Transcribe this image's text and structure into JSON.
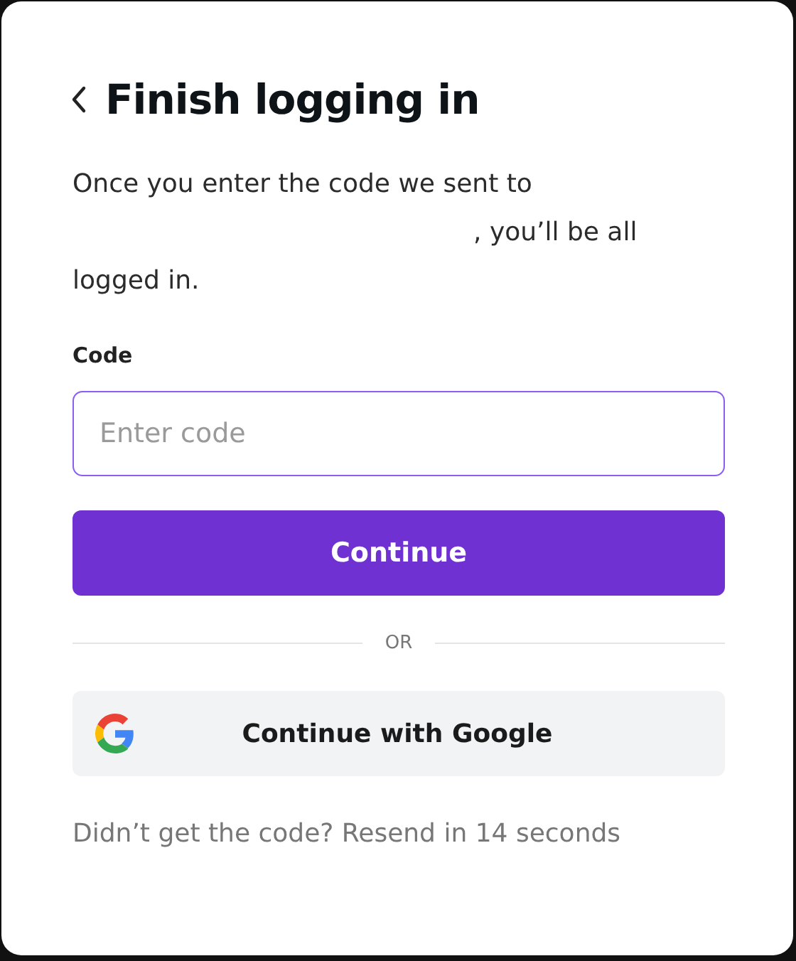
{
  "header": {
    "title": "Finish logging in"
  },
  "description": {
    "before": "Once you enter the code we sent to",
    "after": ", you’ll be all logged in."
  },
  "code_field": {
    "label": "Code",
    "placeholder": "Enter code",
    "focused": true
  },
  "continue_button": {
    "label": "Continue"
  },
  "divider": {
    "label": "OR"
  },
  "google_button": {
    "label": "Continue with Google"
  },
  "resend": {
    "text": "Didn’t get the code? Resend in 14 seconds"
  }
}
